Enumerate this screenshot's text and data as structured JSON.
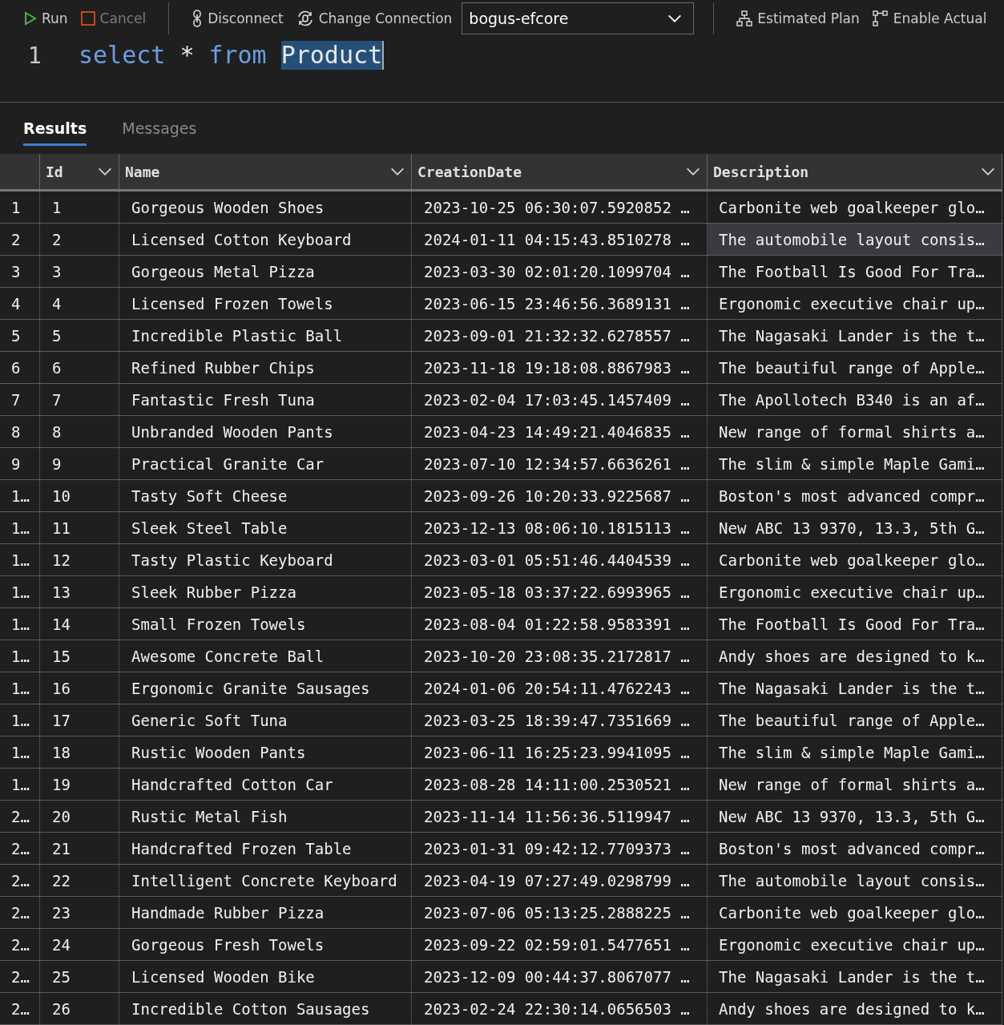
{
  "toolbar": {
    "run": "Run",
    "cancel": "Cancel",
    "disconnect": "Disconnect",
    "change_connection": "Change Connection",
    "database": "bogus-efcore",
    "estimated_plan": "Estimated Plan",
    "enable_actual": "Enable Actual"
  },
  "editor": {
    "lines": [
      {
        "number": "1",
        "tokens": [
          {
            "text": "select",
            "kind": "keyword"
          },
          {
            "text": "*",
            "kind": "plain"
          },
          {
            "text": "from",
            "kind": "keyword"
          },
          {
            "text": "Product",
            "kind": "selected"
          }
        ]
      }
    ]
  },
  "tabs": [
    {
      "label": "Results",
      "selected": true
    },
    {
      "label": "Messages",
      "selected": false
    }
  ],
  "table": {
    "columns": [
      "Id",
      "Name",
      "CreationDate",
      "Description"
    ],
    "rows": [
      {
        "row_number": "1",
        "id": "1",
        "name": "Gorgeous Wooden Shoes",
        "creation_date": "2023-10-25 06:30:07.5920852 …",
        "description": "Carbonite web goalkeeper glo…",
        "hovered": false
      },
      {
        "row_number": "2",
        "id": "2",
        "name": "Licensed Cotton Keyboard",
        "creation_date": "2024-01-11 04:15:43.8510278 …",
        "description": "The automobile layout consis…",
        "hovered": true
      },
      {
        "row_number": "3",
        "id": "3",
        "name": "Gorgeous Metal Pizza",
        "creation_date": "2023-03-30 02:01:20.1099704 …",
        "description": "The Football Is Good For Tra…",
        "hovered": false
      },
      {
        "row_number": "4",
        "id": "4",
        "name": "Licensed Frozen Towels",
        "creation_date": "2023-06-15 23:46:56.3689131 …",
        "description": "Ergonomic executive chair up…",
        "hovered": false
      },
      {
        "row_number": "5",
        "id": "5",
        "name": "Incredible Plastic Ball",
        "creation_date": "2023-09-01 21:32:32.6278557 …",
        "description": "The Nagasaki Lander is the t…",
        "hovered": false
      },
      {
        "row_number": "6",
        "id": "6",
        "name": "Refined Rubber Chips",
        "creation_date": "2023-11-18 19:18:08.8867983 …",
        "description": "The beautiful range of Apple…",
        "hovered": false
      },
      {
        "row_number": "7",
        "id": "7",
        "name": "Fantastic Fresh Tuna",
        "creation_date": "2023-02-04 17:03:45.1457409 …",
        "description": "The Apollotech B340 is an af…",
        "hovered": false
      },
      {
        "row_number": "8",
        "id": "8",
        "name": "Unbranded Wooden Pants",
        "creation_date": "2023-04-23 14:49:21.4046835 …",
        "description": "New range of formal shirts a…",
        "hovered": false
      },
      {
        "row_number": "9",
        "id": "9",
        "name": "Practical Granite Car",
        "creation_date": "2023-07-10 12:34:57.6636261 …",
        "description": "The slim & simple Maple Gami…",
        "hovered": false
      },
      {
        "row_number": "1…",
        "id": "10",
        "name": "Tasty Soft Cheese",
        "creation_date": "2023-09-26 10:20:33.9225687 …",
        "description": "Boston's most advanced compr…",
        "hovered": false
      },
      {
        "row_number": "1…",
        "id": "11",
        "name": "Sleek Steel Table",
        "creation_date": "2023-12-13 08:06:10.1815113 …",
        "description": "New ABC 13 9370, 13.3, 5th G…",
        "hovered": false
      },
      {
        "row_number": "1…",
        "id": "12",
        "name": "Tasty Plastic Keyboard",
        "creation_date": "2023-03-01 05:51:46.4404539 …",
        "description": "Carbonite web goalkeeper glo…",
        "hovered": false
      },
      {
        "row_number": "1…",
        "id": "13",
        "name": "Sleek Rubber Pizza",
        "creation_date": "2023-05-18 03:37:22.6993965 …",
        "description": "Ergonomic executive chair up…",
        "hovered": false
      },
      {
        "row_number": "1…",
        "id": "14",
        "name": "Small Frozen Towels",
        "creation_date": "2023-08-04 01:22:58.9583391 …",
        "description": "The Football Is Good For Tra…",
        "hovered": false
      },
      {
        "row_number": "1…",
        "id": "15",
        "name": "Awesome Concrete Ball",
        "creation_date": "2023-10-20 23:08:35.2172817 …",
        "description": "Andy shoes are designed to k…",
        "hovered": false
      },
      {
        "row_number": "1…",
        "id": "16",
        "name": "Ergonomic Granite Sausages",
        "creation_date": "2024-01-06 20:54:11.4762243 …",
        "description": "The Nagasaki Lander is the t…",
        "hovered": false
      },
      {
        "row_number": "1…",
        "id": "17",
        "name": "Generic Soft Tuna",
        "creation_date": "2023-03-25 18:39:47.7351669 …",
        "description": "The beautiful range of Apple…",
        "hovered": false
      },
      {
        "row_number": "1…",
        "id": "18",
        "name": "Rustic Wooden Pants",
        "creation_date": "2023-06-11 16:25:23.9941095 …",
        "description": "The slim & simple Maple Gami…",
        "hovered": false
      },
      {
        "row_number": "1…",
        "id": "19",
        "name": "Handcrafted Cotton Car",
        "creation_date": "2023-08-28 14:11:00.2530521 …",
        "description": "New range of formal shirts a…",
        "hovered": false
      },
      {
        "row_number": "2…",
        "id": "20",
        "name": "Rustic Metal Fish",
        "creation_date": "2023-11-14 11:56:36.5119947 …",
        "description": "New ABC 13 9370, 13.3, 5th G…",
        "hovered": false
      },
      {
        "row_number": "2…",
        "id": "21",
        "name": "Handcrafted Frozen Table",
        "creation_date": "2023-01-31 09:42:12.7709373 …",
        "description": "Boston's most advanced compr…",
        "hovered": false
      },
      {
        "row_number": "2…",
        "id": "22",
        "name": "Intelligent Concrete Keyboard",
        "creation_date": "2023-04-19 07:27:49.0298799 …",
        "description": "The automobile layout consis…",
        "hovered": false
      },
      {
        "row_number": "2…",
        "id": "23",
        "name": "Handmade Rubber Pizza",
        "creation_date": "2023-07-06 05:13:25.2888225 …",
        "description": "Carbonite web goalkeeper glo…",
        "hovered": false
      },
      {
        "row_number": "2…",
        "id": "24",
        "name": "Gorgeous Fresh Towels",
        "creation_date": "2023-09-22 02:59:01.5477651 …",
        "description": "Ergonomic executive chair up…",
        "hovered": false
      },
      {
        "row_number": "2…",
        "id": "25",
        "name": "Licensed Wooden Bike",
        "creation_date": "2023-12-09 00:44:37.8067077 …",
        "description": "The Nagasaki Lander is the t…",
        "hovered": false
      },
      {
        "row_number": "2…",
        "id": "26",
        "name": "Incredible Cotton Sausages",
        "creation_date": "2023-02-24 22:30:14.0656503 …",
        "description": "Andy shoes are designed to k…",
        "hovered": false
      }
    ]
  }
}
